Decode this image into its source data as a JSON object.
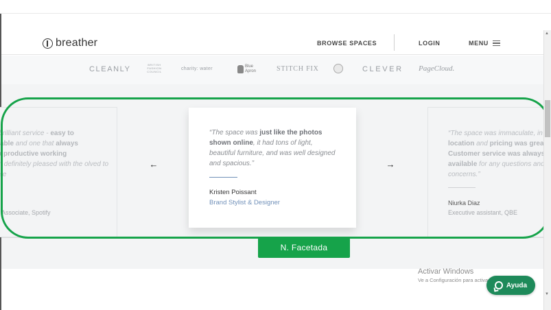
{
  "header": {
    "logo_text": "breather",
    "nav": {
      "browse": "BROWSE SPACES",
      "login": "LOGIN",
      "menu": "MENU"
    }
  },
  "partners": {
    "cleanly": "CLEANLY",
    "bfc": "BRITISH FASHION COUNCIL",
    "charity": "charity: water",
    "apron": "Blue Apron",
    "stitch": "STITCH FIX",
    "clever": "CLEVER",
    "pagecloud": "PageCloud."
  },
  "testimonials": {
    "left": {
      "quote_pre": "a brilliant service - ",
      "quote_b1": "easy to",
      "quote_mid1": " ",
      "quote_b2": "rdable",
      "quote_mid2": " and one that ",
      "quote_b3": "always",
      "quote_b4": "r a productive working",
      "quote_post": " I'm definitely pleased with the olved to date",
      "role": "Associate, Spotify"
    },
    "center": {
      "quote_open": "“The space was ",
      "quote_b1": "just like the photos shown online",
      "quote_post": ", it had tons of light, beautiful furniture, and was well designed and spacious.”",
      "name": "Kristen Poissant",
      "role": "Brand Stylist & Designer"
    },
    "right": {
      "quote_open": "“The space was immaculate, in a ",
      "quote_b1": "location",
      "quote_mid": " and ",
      "quote_b2": "pricing was great. Customer service was always available",
      "quote_post": " for any questions and concerns.”",
      "name": "Niurka Diaz",
      "role": "Executive assistant, QBE"
    }
  },
  "carousel": {
    "prev": "←",
    "next": "→"
  },
  "annotation": {
    "label": "N. Facetada",
    "color": "#16a34a"
  },
  "windows": {
    "title": "Activar Windows",
    "subtitle": "Ve a Configuración para activar Windows."
  },
  "help": {
    "label": "Ayuda"
  }
}
